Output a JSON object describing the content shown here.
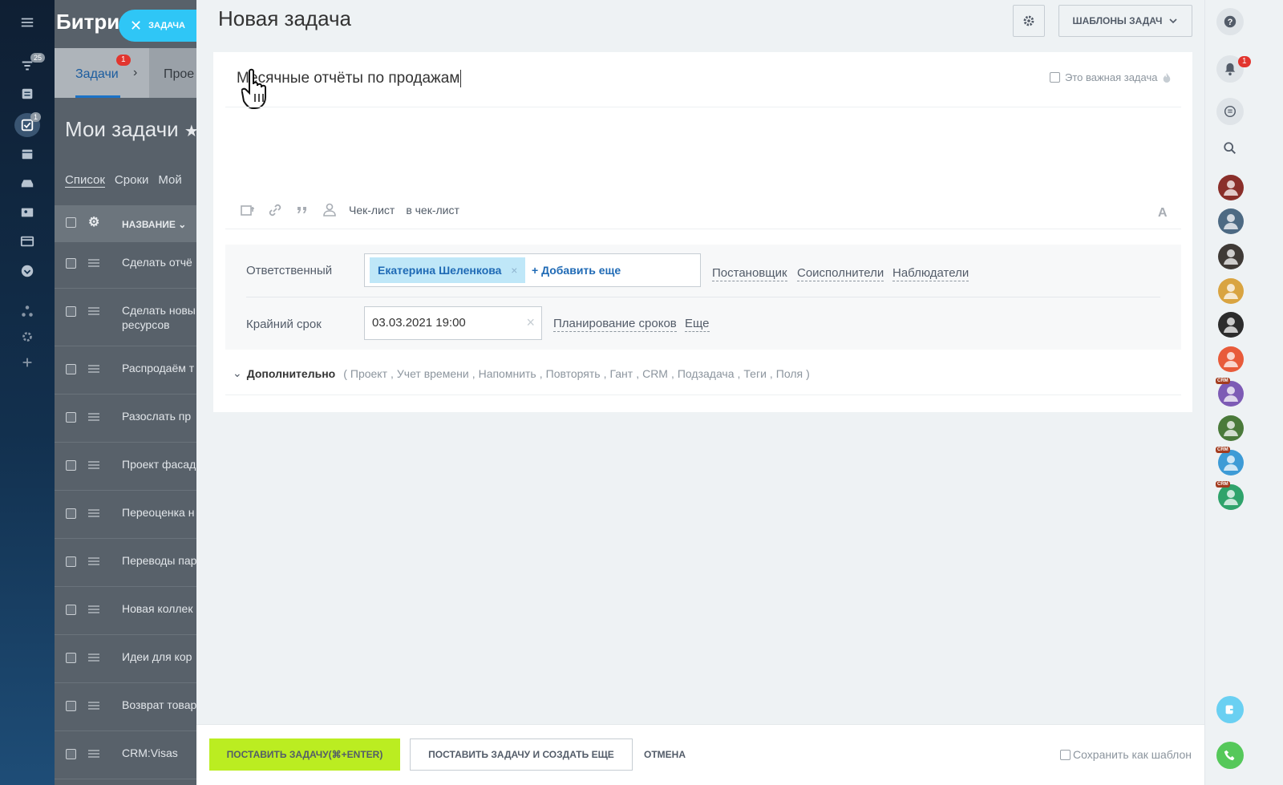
{
  "background_app": {
    "brand": "Битри",
    "left_nav_counters": {
      "filter": "25",
      "tasks": "1"
    },
    "tabs": [
      {
        "label": "Задачи",
        "badge": "1"
      },
      {
        "label": "Прое"
      }
    ],
    "page_title": "Мои задачи",
    "view_tabs": [
      "Список",
      "Сроки",
      "Мой"
    ],
    "column_header": "НАЗВАНИЕ",
    "rows": [
      "Сделать отчё",
      "Сделать новы ресурсов",
      "Распродаём т",
      "Разослать пр",
      "Проект фасад",
      "Переоценка н",
      "Переводы пар",
      "Новая коллек",
      "Идеи для кор",
      "Возврат товар",
      "CRM:Visas"
    ]
  },
  "close_pill": {
    "label": "ЗАДАЧА"
  },
  "slider": {
    "title": "Новая задача",
    "templates_button": "ШАБЛОНЫ ЗАДАЧ",
    "task_title": "Месячные отчёты по продажам",
    "important_label": "Это важная задача",
    "toolbar": {
      "checklist": "Чек-лист",
      "to_checklist": "в чек-лист",
      "font_letter": "A"
    },
    "fields": {
      "responsible_label": "Ответственный",
      "responsible_person": "Екатерина Шеленкова",
      "add_more": "Добавить еще",
      "role_links": [
        "Постановщик",
        "Соисполнители",
        "Наблюдатели"
      ],
      "deadline_label": "Крайний срок",
      "deadline_value": "03.03.2021 19:00",
      "planning_link": "Планирование сроков",
      "more_link": "Еще"
    },
    "extra": {
      "label": "Дополнительно",
      "items": [
        "Проект",
        "Учет времени",
        "Напомнить",
        "Повторять",
        "Гант",
        "CRM",
        "Подзадача",
        "Теги",
        "Поля"
      ]
    },
    "footer": {
      "save": "ПОСТАВИТЬ ЗАДАЧУ(⌘+ENTER)",
      "save_and_more": "ПОСТАВИТЬ ЗАДАЧУ И СОЗДАТЬ ЕЩЕ",
      "cancel": "ОТМЕНА",
      "save_template": "Сохранить как шаблон"
    }
  },
  "right_bar": {
    "notification_badge": "1",
    "crm_tag": "CRM",
    "avatar_colors": [
      "#8a2f2a",
      "#4d6a83",
      "#3f3a36",
      "#d9a441",
      "#2c2c2c",
      "#e85b3a",
      "#7d5bb5",
      "#4a7a3a",
      "#3d9bd6",
      "#2fa36b"
    ]
  },
  "colors": {
    "accent_green": "#bbed21",
    "accent_blue": "#2fc6f6",
    "link_blue": "#1f6ab5",
    "badge_red": "#e2352e"
  }
}
